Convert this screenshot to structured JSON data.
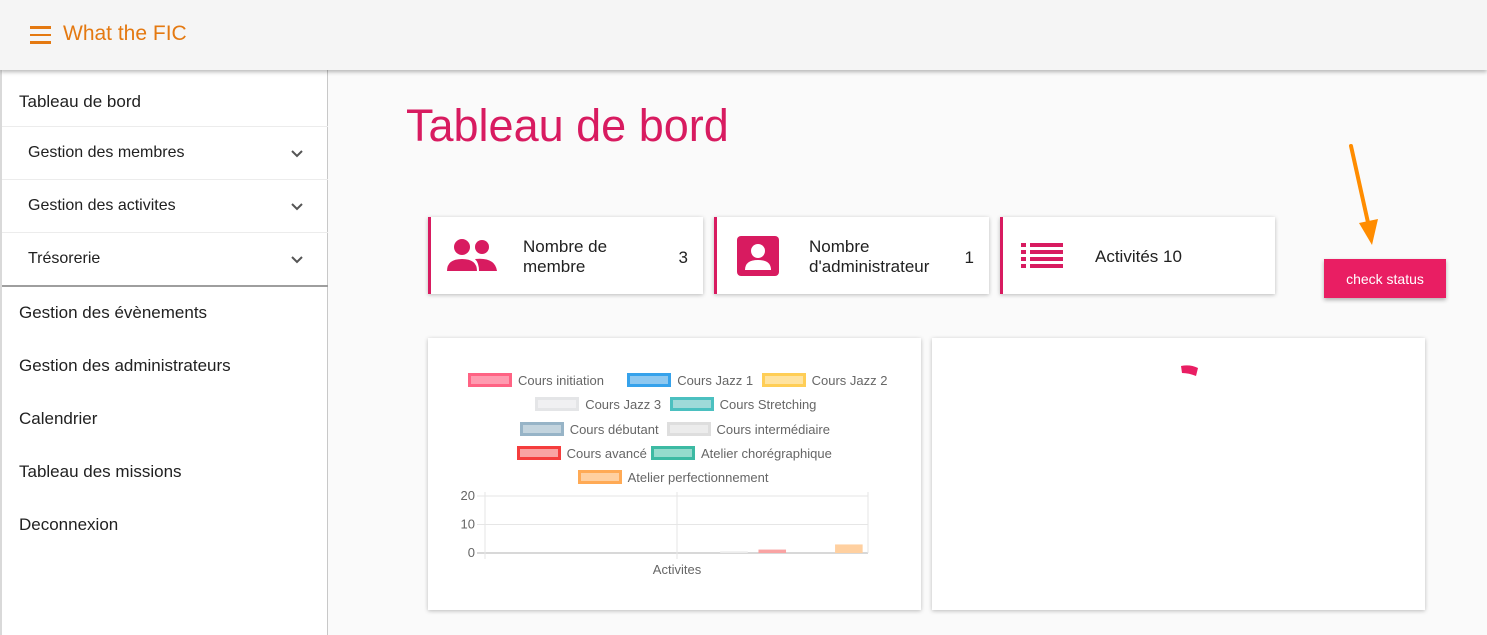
{
  "app": {
    "title": "What the FIC"
  },
  "sidebar": {
    "top_item": "Tableau de bord",
    "groups": [
      {
        "label": "Gestion des membres"
      },
      {
        "label": "Gestion des activites"
      },
      {
        "label": "Trésorerie"
      }
    ],
    "items": [
      {
        "label": "Gestion des évènements"
      },
      {
        "label": "Gestion des administrateurs"
      },
      {
        "label": "Calendrier"
      },
      {
        "label": "Tableau des missions"
      },
      {
        "label": "Deconnexion"
      }
    ]
  },
  "main": {
    "title": "Tableau de bord",
    "cards": [
      {
        "label_line1": "Nombre de",
        "label_line2": "membre",
        "value": "3",
        "icon": "people-icon"
      },
      {
        "label_line1": "Nombre",
        "label_line2": "d'administrateur",
        "value": "1",
        "icon": "account-box-icon"
      },
      {
        "label_line1": "Activités 10",
        "label_line2": "",
        "value": "",
        "icon": "list-icon"
      }
    ],
    "check_status_label": "check status"
  },
  "colors": {
    "accent": "#d81b60",
    "button": "#e91e63",
    "brand": "#e47911",
    "arrow": "#ff8c00"
  },
  "chart_data": {
    "type": "bar",
    "categories": [
      "Activites"
    ],
    "xlabel": "Activites",
    "ylabel": "",
    "ylim": [
      0,
      20
    ],
    "yticks": [
      "0",
      "10",
      "20"
    ],
    "series": [
      {
        "name": "Cours initiation",
        "values": [
          0
        ],
        "fill": "#ff9bb0",
        "border": "#ff6384"
      },
      {
        "name": "Cours Jazz 1",
        "values": [
          0
        ],
        "fill": "#8ec8f0",
        "border": "#36a2eb"
      },
      {
        "name": "Cours Jazz 2",
        "values": [
          0
        ],
        "fill": "#ffe3a0",
        "border": "#ffce56"
      },
      {
        "name": "Cours Jazz 3",
        "values": [
          0
        ],
        "fill": "#f0f0f2",
        "border": "#e4e5e7"
      },
      {
        "name": "Cours Stretching",
        "values": [
          0
        ],
        "fill": "#9fdad9",
        "border": "#4bc0c0"
      },
      {
        "name": "Cours débutant",
        "values": [
          0
        ],
        "fill": "#c3d4de",
        "border": "#97b4c7"
      },
      {
        "name": "Cours intermédiaire",
        "values": [
          0.6
        ],
        "fill": "#ececec",
        "border": "#dedede"
      },
      {
        "name": "Cours avancé",
        "values": [
          1.2
        ],
        "fill": "#f9a3a3",
        "border": "#f53d3d"
      },
      {
        "name": "Atelier chorégraphique",
        "values": [
          0
        ],
        "fill": "#95dccd",
        "border": "#3cbaa3"
      },
      {
        "name": "Atelier perfectionnement",
        "values": [
          3
        ],
        "fill": "#ffd0a0",
        "border": "#ffaa55"
      }
    ]
  }
}
